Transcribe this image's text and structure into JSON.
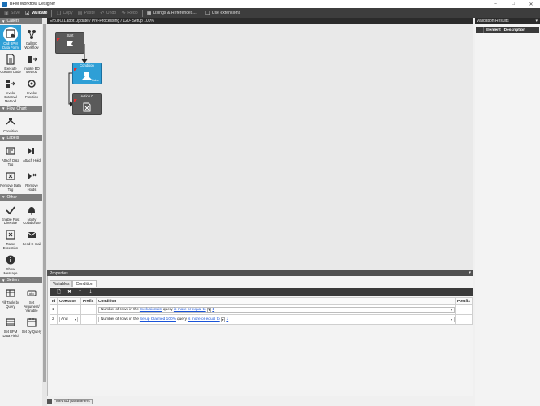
{
  "window": {
    "title": "BPM Workflow Designer",
    "controls": [
      "–",
      "□",
      "✕"
    ]
  },
  "toolbar": {
    "save": "Save",
    "validate": "Validate",
    "copy": "Copy",
    "paste": "Paste",
    "undo": "Undo",
    "redo": "Redo",
    "usings": "Usings & References...",
    "use_extensions": "Use extensions"
  },
  "toolbox": {
    "sections": [
      {
        "title": "Callers",
        "items": [
          "Call BPM Data Form",
          "Call BC Workflow",
          "Execute Custom Code",
          "Invoke BO Method",
          "Invoke External Method",
          "Invoke Function"
        ]
      },
      {
        "title": "Flow Chart",
        "items": [
          "Condition"
        ]
      },
      {
        "title": "Labels",
        "items": [
          "Attach Data Tag",
          "Attach Hold",
          "Remove Data Tag",
          "Remove Holds"
        ]
      },
      {
        "title": "Other",
        "items": [
          "Enable Post Directive",
          "Notify Collaborate",
          "Raise Exception",
          "Send E-mail",
          "Show Message"
        ]
      },
      {
        "title": "Setters",
        "items": [
          "Fill Table by Query",
          "Set Argument/ Variable",
          "Set BPM Data Field",
          "Set by Query"
        ]
      }
    ]
  },
  "document": {
    "path": "Erp.BO.Labor.Update / Pre-Processing / 120- Setup 100%"
  },
  "canvas": {
    "nodes": [
      {
        "title": "Start"
      },
      {
        "title": "Condition",
        "badge": "False"
      },
      {
        "title": "Action 0"
      }
    ]
  },
  "properties": {
    "title": "Properties",
    "pin": "▾",
    "tabs": [
      "Variables",
      "Condition"
    ],
    "columns": [
      "Id",
      "Operator",
      "Prefix",
      "Condition",
      "Postfix"
    ],
    "rows": [
      {
        "id": "1",
        "operator": "",
        "prefix": "",
        "cond_prefix": "Number of rows in the",
        "query_link": "ExclusionList",
        "cond_mid": "query",
        "compare_link": "is more or equal to",
        "value_link": "1",
        "postfix": ""
      },
      {
        "id": "2",
        "operator": "And",
        "prefix": "",
        "cond_prefix": "Number of rows in the",
        "query_link": "Setup Claimed 100%",
        "cond_mid": "query",
        "compare_link": "is more or equal to",
        "value_link": "1",
        "postfix": ""
      }
    ]
  },
  "method_parameters": {
    "label": "Method parameters"
  },
  "validation": {
    "title": "Validation Results",
    "columns": [
      "Element",
      "Description"
    ]
  }
}
